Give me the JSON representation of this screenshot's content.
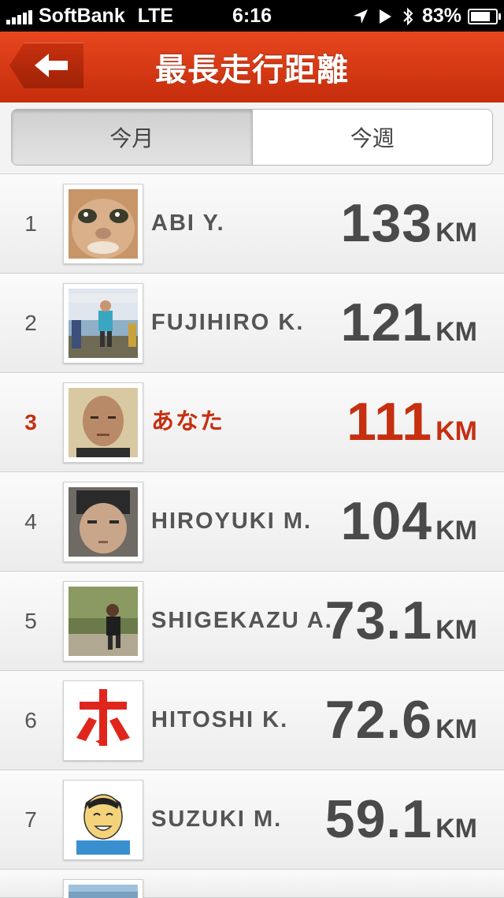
{
  "status_bar": {
    "carrier": "SoftBank",
    "network": "LTE",
    "time": "6:16",
    "battery": "83%"
  },
  "header": {
    "title": "最長走行距離",
    "back_icon": "back-arrow-icon",
    "accent_color": "#d73a16"
  },
  "tabs": [
    {
      "label": "今月",
      "active": true
    },
    {
      "label": "今週",
      "active": false
    }
  ],
  "leaderboard": [
    {
      "rank": "1",
      "name": "ABI Y.",
      "distance": "133",
      "unit": "KM",
      "avatar": "cat-photo"
    },
    {
      "rank": "2",
      "name": "FUJIHIRO K.",
      "distance": "121",
      "unit": "KM",
      "avatar": "runner-photo"
    },
    {
      "rank": "3",
      "name": "あなた",
      "distance": "111",
      "unit": "KM",
      "avatar": "face-photo",
      "highlight": true
    },
    {
      "rank": "4",
      "name": "HIROYUKI M.",
      "distance": "104",
      "unit": "KM",
      "avatar": "face-photo"
    },
    {
      "rank": "5",
      "name": "SHIGEKAZU A.",
      "distance": "73.1",
      "unit": "KM",
      "avatar": "runner-photo"
    },
    {
      "rank": "6",
      "name": "HITOSHI K.",
      "distance": "72.6",
      "unit": "KM",
      "avatar": "katakana-ho-logo"
    },
    {
      "rank": "7",
      "name": "SUZUKI M.",
      "distance": "59.1",
      "unit": "KM",
      "avatar": "cartoon-face"
    }
  ],
  "highlight_color": "#c62f10"
}
